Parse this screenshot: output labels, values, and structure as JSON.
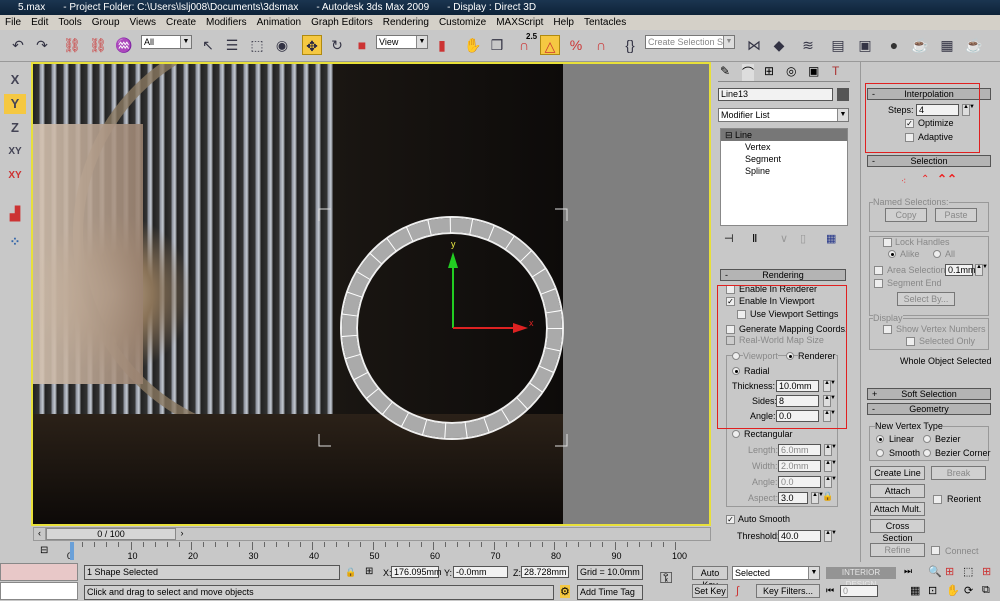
{
  "title_bar": {
    "file": "5.max",
    "project": "- Project Folder: C:\\Users\\lslj008\\Documents\\3dsmax",
    "app": "- Autodesk 3ds Max  2009",
    "display": "- Display : Direct 3D"
  },
  "menu": [
    "File",
    "Edit",
    "Tools",
    "Group",
    "Views",
    "Create",
    "Modifiers",
    "Animation",
    "Graph Editors",
    "Rendering",
    "Customize",
    "MAXScript",
    "Help",
    "Tentacles"
  ],
  "toolbar": {
    "selection_filter": "All",
    "ref_coord": "View",
    "snap_label": "2.5",
    "named_selection_placeholder": "Create Selection Set"
  },
  "left_tools": [
    "X",
    "Y",
    "Z",
    "XY",
    "XY"
  ],
  "viewport": {
    "gizmo_y": "y",
    "gizmo_x": "x"
  },
  "command_panel": {
    "object_name": "Line13",
    "object_color": "#555555",
    "modifier_list": "Modifier List",
    "stack": [
      {
        "label": "Line"
      },
      {
        "label": "Vertex"
      },
      {
        "label": "Segment"
      },
      {
        "label": "Spline"
      }
    ],
    "rendering": {
      "title": "Rendering",
      "enable_renderer": "Enable In Renderer",
      "enable_viewport": "Enable In Viewport",
      "use_viewport_settings": "Use Viewport Settings",
      "gen_mapping": "Generate Mapping Coords.",
      "real_world": "Real-World Map Size",
      "viewport": "Viewport",
      "renderer": "Renderer",
      "radial": "Radial",
      "thickness_label": "Thickness:",
      "thickness": "10.0mm",
      "sides_label": "Sides:",
      "sides": "8",
      "angle_label": "Angle:",
      "angle": "0.0",
      "rectangular": "Rectangular",
      "length_label": "Length:",
      "length": "6.0mm",
      "width_label": "Width:",
      "width": "2.0mm",
      "angle2_label": "Angle:",
      "angle2": "0.0",
      "aspect_label": "Aspect:",
      "aspect": "3.0",
      "auto_smooth": "Auto Smooth",
      "threshold_label": "Threshold:",
      "threshold": "40.0"
    },
    "interpolation": {
      "title": "Interpolation",
      "steps_label": "Steps:",
      "steps": "4",
      "optimize": "Optimize",
      "adaptive": "Adaptive"
    },
    "selection": {
      "title": "Selection",
      "named_selections": "Named Selections:",
      "copy": "Copy",
      "paste": "Paste",
      "lock_handles": "Lock Handles",
      "alike": "Alike",
      "all": "All",
      "area_selection": "Area Selection:",
      "area_value": "0.1mm",
      "segment_end": "Segment End",
      "select_by": "Select By...",
      "display": "Display",
      "show_vertex_numbers": "Show Vertex Numbers",
      "selected_only": "Selected Only",
      "status": "Whole Object Selected"
    },
    "soft_selection": {
      "title": "Soft Selection"
    },
    "geometry": {
      "title": "Geometry",
      "new_vertex_type": "New Vertex Type",
      "linear": "Linear",
      "bezier": "Bezier",
      "smooth": "Smooth",
      "bezier_corner": "Bezier Corner",
      "create_line": "Create Line",
      "break": "Break",
      "attach": "Attach",
      "reorient": "Reorient",
      "attach_mult": "Attach Mult.",
      "cross_section": "Cross Section",
      "refine": "Refine",
      "connect": "Connect"
    }
  },
  "timeline": {
    "slider": "0 / 100",
    "ticks": [
      "0",
      "10",
      "20",
      "30",
      "40",
      "50",
      "60",
      "70",
      "80",
      "90",
      "100"
    ]
  },
  "status": {
    "selection": "1 Shape Selected",
    "prompt": "Click and drag to select and move objects",
    "x_label": "X:",
    "x": "176.095mm",
    "y_label": "Y:",
    "y": "-0.0mm",
    "z_label": "Z:",
    "z": "28.728mm",
    "grid": "Grid = 10.0mm",
    "add_time_tag": "Add Time Tag",
    "auto_key": "Auto Key",
    "set_key": "Set Key",
    "key_mode": "Selected",
    "key_filters": "Key Filters...",
    "frame": "0",
    "watermark": "INTERIOR DESIGN"
  }
}
